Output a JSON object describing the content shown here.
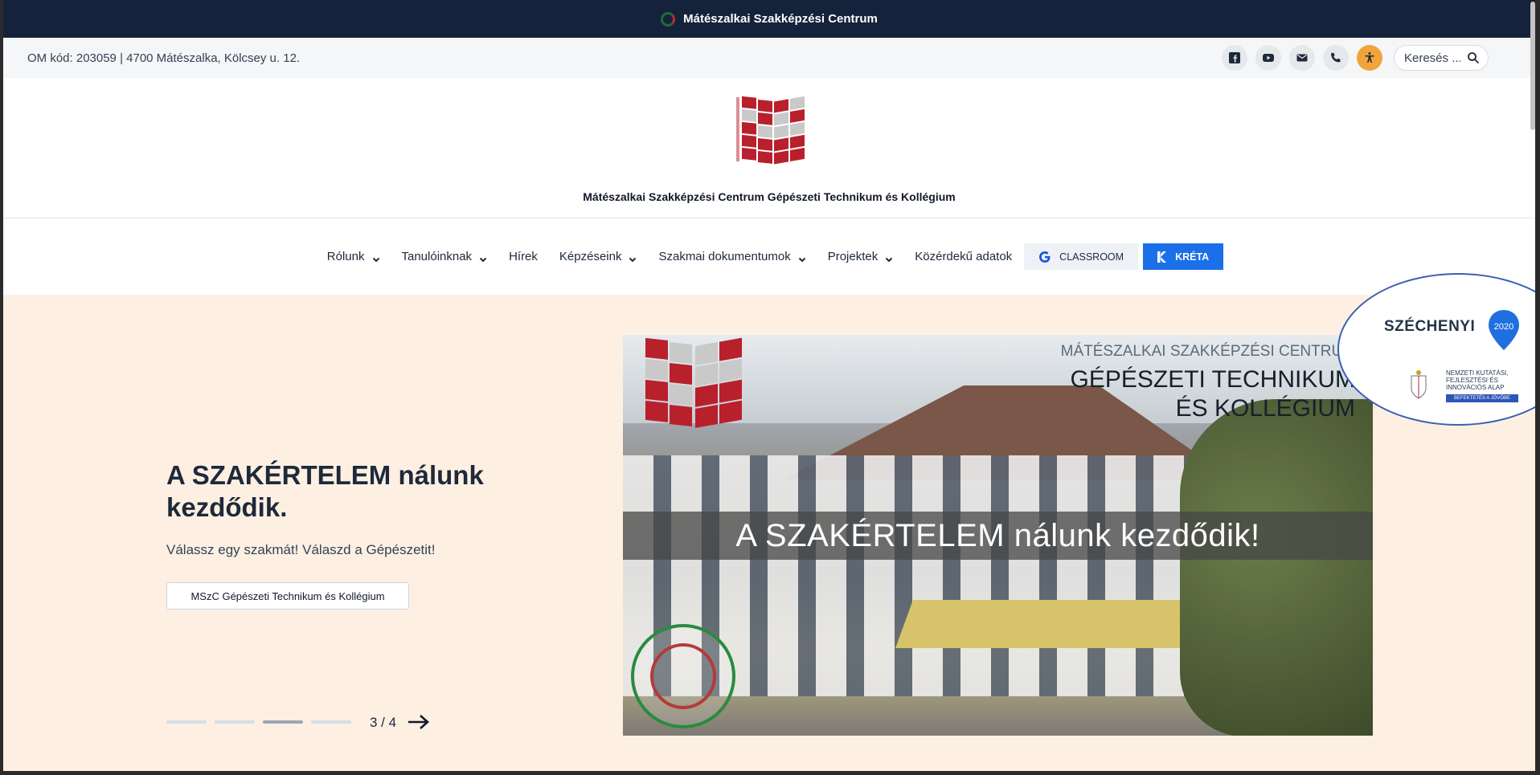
{
  "topbar": {
    "title": "Mátészalkai Szakképzési Centrum"
  },
  "infobar": {
    "address": "OM kód: 203059 | 4700 Mátészalka, Kölcsey u. 12.",
    "icons": [
      "facebook-icon",
      "youtube-icon",
      "email-icon",
      "phone-icon",
      "accessibility-icon"
    ],
    "search_placeholder": "Keresés ..."
  },
  "header": {
    "school_name": "Mátészalkai Szakképzési Centrum Gépészeti Technikum és Kollégium"
  },
  "nav": {
    "items": [
      {
        "label": "Rólunk",
        "dropdown": true
      },
      {
        "label": "Tanulóinknak",
        "dropdown": true
      },
      {
        "label": "Hírek",
        "dropdown": false
      },
      {
        "label": "Képzéseink",
        "dropdown": true
      },
      {
        "label": "Szakmai dokumentumok",
        "dropdown": true
      },
      {
        "label": "Projektek",
        "dropdown": true
      },
      {
        "label": "Közérdekű adatok",
        "dropdown": false
      }
    ],
    "classroom": "CLASSROOM",
    "kreta": "KRÉTA"
  },
  "hero": {
    "title": "A SZAKÉRTELEM nálunk kezdődik.",
    "subtitle": "Válassz egy szakmát! Válaszd a Gépészetit!",
    "button": "MSzC Gépészeti Technikum és Kollégium",
    "counter": "3 / 4",
    "slides_total": 4,
    "active_slide": 3
  },
  "slide_image": {
    "caption_top": "MÁTÉSZALKAI SZAKKÉPZÉSI CENTRUM",
    "caption_main_1": "GÉPÉSZETI TECHNIKUM",
    "caption_main_2": "ÉS KOLLÉGIUM",
    "banner": "A SZAKÉRTELEM nálunk kezdődik!"
  },
  "szechenyi": {
    "title": "SZÉCHENYI",
    "year": "2020",
    "text": "NEMZETI KUTATÁSI, FEJLESZTÉSI ÉS INNOVÁCIÓS ALAP",
    "strip": "BEFEKTETÉS A JÖVŐBE"
  },
  "colors": {
    "topbar": "#15223b",
    "hero_bg": "#fdf0e2",
    "kreta": "#1b6fe8",
    "accessibility": "#f2a43a",
    "logo_red": "#b8202c"
  }
}
